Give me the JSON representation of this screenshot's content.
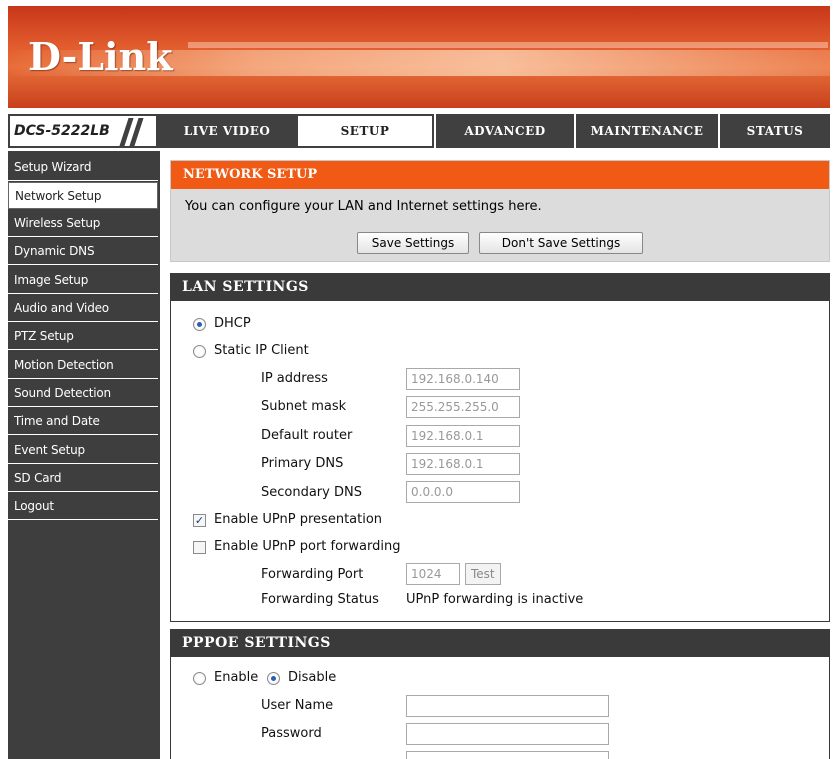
{
  "header": {
    "logo": "D-Link"
  },
  "model": "DCS-5222LB",
  "nav": [
    {
      "label": "LIVE VIDEO",
      "active": false
    },
    {
      "label": "SETUP",
      "active": true
    },
    {
      "label": "ADVANCED",
      "active": false
    },
    {
      "label": "MAINTENANCE",
      "active": false
    },
    {
      "label": "STATUS",
      "active": false
    }
  ],
  "sidebar": [
    {
      "label": "Setup Wizard",
      "active": false
    },
    {
      "label": "Network Setup",
      "active": true
    },
    {
      "label": "Wireless Setup",
      "active": false
    },
    {
      "label": "Dynamic DNS",
      "active": false
    },
    {
      "label": "Image Setup",
      "active": false
    },
    {
      "label": "Audio and Video",
      "active": false
    },
    {
      "label": "PTZ Setup",
      "active": false
    },
    {
      "label": "Motion Detection",
      "active": false
    },
    {
      "label": "Sound Detection",
      "active": false
    },
    {
      "label": "Time and Date",
      "active": false
    },
    {
      "label": "Event Setup",
      "active": false
    },
    {
      "label": "SD Card",
      "active": false
    },
    {
      "label": "Logout",
      "active": false
    }
  ],
  "network": {
    "title": "NETWORK SETUP",
    "description": "You can configure your LAN and Internet settings here.",
    "save_label": "Save Settings",
    "dont_save_label": "Don't Save Settings"
  },
  "lan": {
    "title": "LAN SETTINGS",
    "dhcp_label": "DHCP",
    "dhcp_selected": true,
    "static_label": "Static IP Client",
    "static_selected": false,
    "ip_label": "IP address",
    "ip_value": "192.168.0.140",
    "subnet_label": "Subnet mask",
    "subnet_value": "255.255.255.0",
    "router_label": "Default router",
    "router_value": "192.168.0.1",
    "pdns_label": "Primary DNS",
    "pdns_value": "192.168.0.1",
    "sdns_label": "Secondary DNS",
    "sdns_value": "0.0.0.0",
    "upnp_pres_label": "Enable UPnP presentation",
    "upnp_pres_checked": true,
    "upnp_port_label": "Enable UPnP port forwarding",
    "upnp_port_checked": false,
    "fwd_port_label": "Forwarding Port",
    "fwd_port_value": "1024",
    "test_label": "Test",
    "fwd_status_label": "Forwarding Status",
    "fwd_status_value": "UPnP forwarding is inactive"
  },
  "pppoe": {
    "title": "PPPOE SETTINGS",
    "enable_label": "Enable",
    "enable_selected": false,
    "disable_label": "Disable",
    "disable_selected": true,
    "user_label": "User Name",
    "user_value": "",
    "password_label": "Password",
    "password_value": ""
  },
  "colors": {
    "header_accent": "#e25d2e",
    "section_title_orange": "#f05a14",
    "nav_dark": "#404040",
    "section_title_dark": "#3a3a3a"
  }
}
